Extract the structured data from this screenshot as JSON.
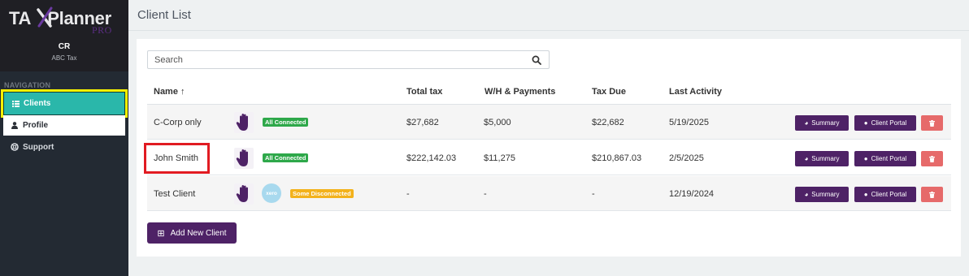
{
  "sidebar": {
    "logo_text": "TAX Planner",
    "logo_sub": "PRO",
    "user_initials": "CR",
    "user_company": "ABC Tax",
    "nav_title": "NAVIGATION",
    "items": [
      {
        "label": "Clients",
        "icon": "list-icon",
        "active": true
      },
      {
        "label": "Profile",
        "icon": "user-icon"
      },
      {
        "label": "Support",
        "icon": "lifebuoy-icon"
      }
    ]
  },
  "header": {
    "title": "Client List"
  },
  "search": {
    "placeholder": "Search",
    "value": ""
  },
  "table": {
    "columns": [
      "Name ↑",
      "Total tax",
      "W/H & Payments",
      "Tax Due",
      "Last Activity"
    ],
    "rows": [
      {
        "name": "C-Corp only",
        "status": "All Connected",
        "xero": "",
        "total_tax": "$27,682",
        "payments": "$5,000",
        "tax_due": "$22,682",
        "last_activity": "5/19/2025"
      },
      {
        "name": "John Smith",
        "status": "All Connected",
        "xero": "",
        "total_tax": "$222,142.03",
        "payments": "$11,275",
        "tax_due": "$210,867.03",
        "last_activity": "2/5/2025"
      },
      {
        "name": "Test Client",
        "status": "Some Disconnected",
        "xero": "xero",
        "total_tax": "-",
        "payments": "-",
        "tax_due": "-",
        "last_activity": "12/19/2024"
      }
    ],
    "actions": {
      "summary": "Summary",
      "portal": "Client Portal"
    }
  },
  "add_button": {
    "label": "Add New Client"
  },
  "colors": {
    "brand_purple": "#4e2266",
    "accent_teal": "#2ab7aa",
    "connected_green": "#2ea84a",
    "disconnected_orange": "#f3b21c",
    "delete_red": "#e66a6a",
    "highlight_yellow": "#f6f000",
    "highlight_red": "#e11b22"
  }
}
